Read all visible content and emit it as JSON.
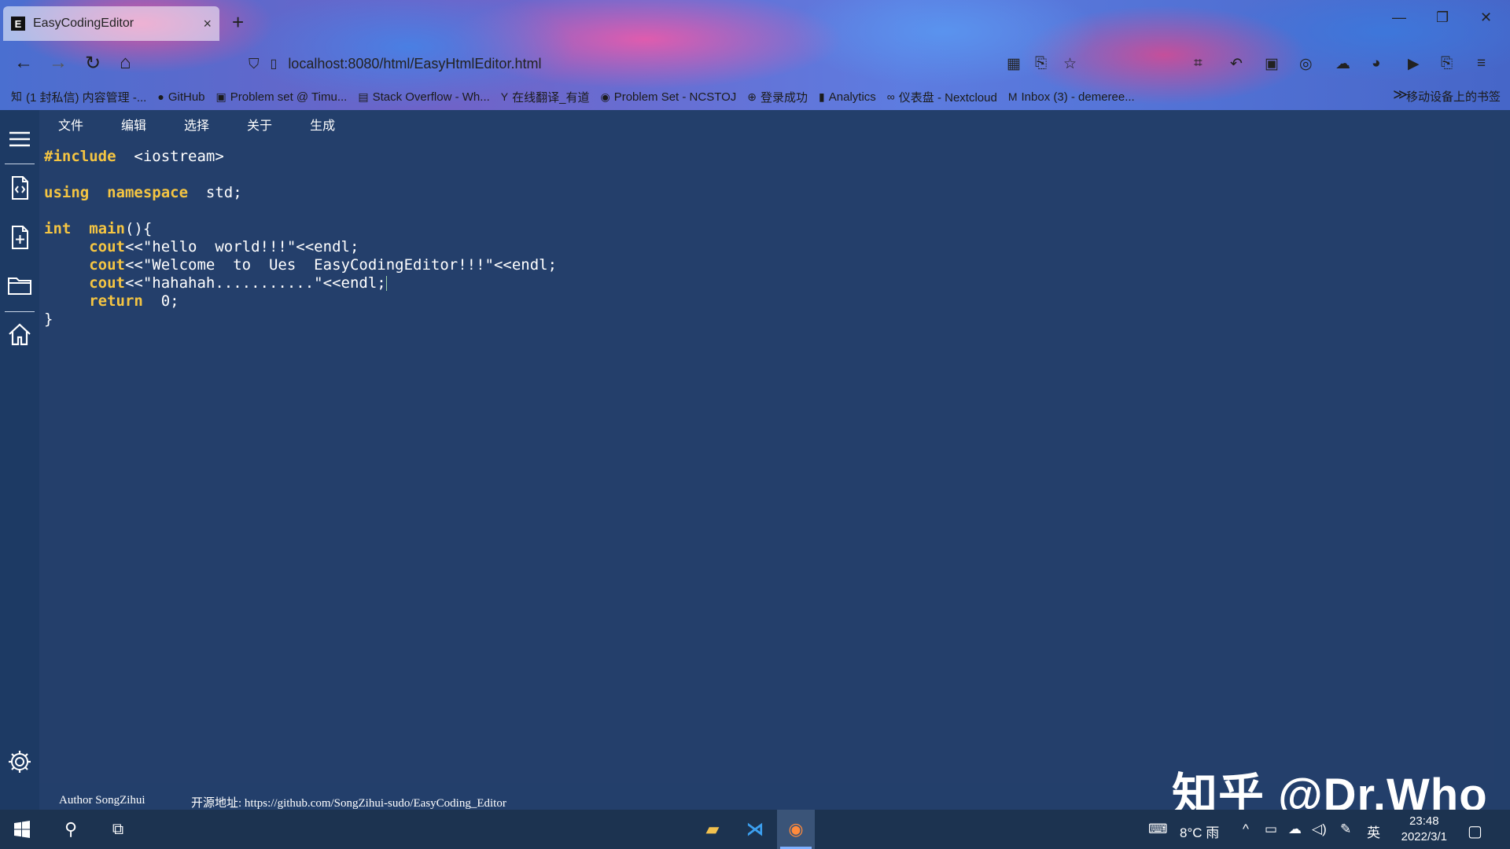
{
  "browser": {
    "tab_title": "EasyCodingEditor",
    "tab_favicon": "E",
    "tab_close": "×",
    "new_tab": "+",
    "url": "localhost:8080/html/EasyHtmlEditor.html",
    "window_controls": {
      "minimize": "—",
      "restore": "❐",
      "close": "✕"
    },
    "bookmarks": [
      {
        "icon": "知",
        "label": "(1 封私信) 内容管理 -..."
      },
      {
        "icon": "●",
        "label": "GitHub"
      },
      {
        "icon": "▣",
        "label": "Problem set @ Timu..."
      },
      {
        "icon": "▤",
        "label": "Stack Overflow - Wh..."
      },
      {
        "icon": "Y",
        "label": "在线翻译_有道"
      },
      {
        "icon": "◉",
        "label": "Problem Set - NCSTOJ"
      },
      {
        "icon": "⊕",
        "label": "登录成功"
      },
      {
        "icon": "▮",
        "label": "Analytics"
      },
      {
        "icon": "∞",
        "label": "仪表盘 - Nextcloud"
      },
      {
        "icon": "M",
        "label": "Inbox (3) - demeree..."
      }
    ],
    "bookmarks_more": "≫",
    "mobile_bookmarks": "移动设备上的书签"
  },
  "app": {
    "menu": [
      "文件",
      "编辑",
      "选择",
      "关于",
      "生成"
    ],
    "code_lines": [
      "#include  <iostream>",
      "",
      "using  namespace  std;",
      "",
      "int  main(){",
      "     cout<<\"hello  world!!!\"<<endl;",
      "     cout<<\"Welcome  to  Ues  EasyCodingEditor!!!\"<<endl;",
      "     cout<<\"hahahah...........\"<<endl;",
      "     return  0;",
      "}"
    ],
    "footer": {
      "author": "Author SongZihui",
      "repo": "开源地址: https://github.com/SongZihui-sudo/EasyCoding_Editor"
    },
    "colors": {
      "background": "#243f6b",
      "sidebar": "#1d3a64",
      "keyword": "#f5c542"
    }
  },
  "watermark": "知乎 @Dr.Who",
  "taskbar": {
    "weather": "8°C 雨",
    "ime": "英",
    "time": "23:48",
    "date": "2022/3/1"
  }
}
